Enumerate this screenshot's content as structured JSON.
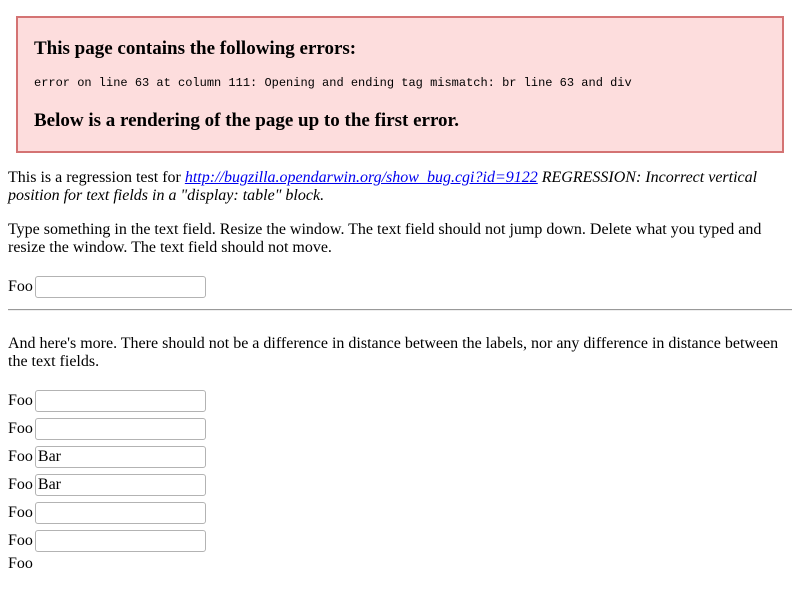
{
  "error_box": {
    "heading": "This page contains the following errors:",
    "detail": "error on line 63 at column 111: Opening and ending tag mismatch: br line 63 and div",
    "footer": "Below is a rendering of the page up to the first error."
  },
  "intro": {
    "prefix": "This is a regression test for ",
    "link_text": "http://bugzilla.opendarwin.org/show_bug.cgi?id=9122",
    "suffix": " REGRESSION: Incorrect vertical position for text fields in a \"display: table\" block."
  },
  "instructions": "Type something in the text field. Resize the window. The text field should not jump down. Delete what you typed and resize the window. The text field should not move.",
  "first_field": {
    "label": "Foo",
    "value": ""
  },
  "more_text": "And here's more. There should not be a difference in distance between the labels, nor any difference in distance between the text fields.",
  "fields": [
    {
      "label": "Foo",
      "value": ""
    },
    {
      "label": "Foo",
      "value": ""
    },
    {
      "label": "Foo",
      "value": "Bar"
    },
    {
      "label": "Foo",
      "value": "Bar"
    },
    {
      "label": "Foo",
      "value": ""
    },
    {
      "label": "Foo",
      "value": ""
    }
  ],
  "trailing_label": "Foo"
}
